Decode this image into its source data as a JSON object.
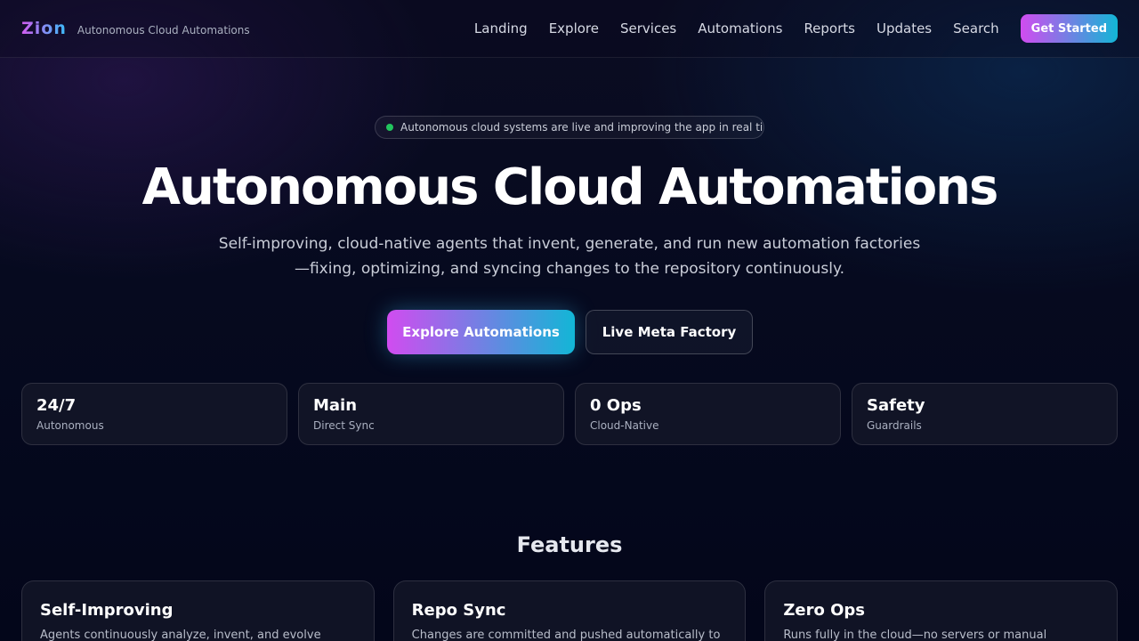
{
  "header": {
    "logo": "Zion",
    "tagline": "Autonomous Cloud Automations",
    "nav": [
      "Landing",
      "Explore",
      "Services",
      "Automations",
      "Reports",
      "Updates",
      "Search"
    ],
    "cta": "Get Started"
  },
  "hero": {
    "status_text": "Autonomous cloud systems are live and improving the app in real time",
    "title": "Autonomous Cloud Automations",
    "subtitle": "Self-improving, cloud-native agents that invent, generate, and run new automation factories —fixing, optimizing, and syncing changes to the repository continuously.",
    "primary_button": "Explore Automations",
    "secondary_button": "Live Meta Factory"
  },
  "stats": [
    {
      "value": "24/7",
      "label": "Autonomous"
    },
    {
      "value": "Main",
      "label": "Direct Sync"
    },
    {
      "value": "0 Ops",
      "label": "Cloud-Native"
    },
    {
      "value": "Safety",
      "label": "Guardrails"
    }
  ],
  "features": {
    "title": "Features",
    "items": [
      {
        "title": "Self-Improving",
        "desc": "Agents continuously analyze, invent, and evolve"
      },
      {
        "title": "Repo Sync",
        "desc": "Changes are committed and pushed automatically to"
      },
      {
        "title": "Zero Ops",
        "desc": "Runs fully in the cloud—no servers or manual"
      }
    ]
  },
  "colors": {
    "accent_start": "#d14cf0",
    "accent_end": "#12b6d6",
    "status_live": "#22c55e",
    "background": "#060a1f"
  }
}
